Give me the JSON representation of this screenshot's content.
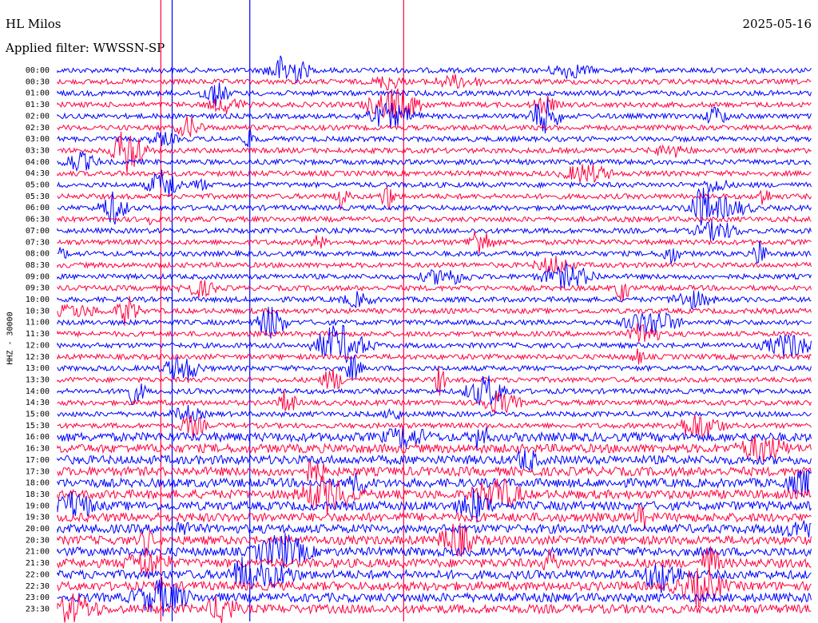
{
  "header": {
    "station": "HL Milos",
    "date": "2025-05-16",
    "filter": "Applied filter: WWSSN-SP"
  },
  "chart_data": {
    "type": "line",
    "title": "HL Milos",
    "subtitle": "Applied filter: WWSSN-SP",
    "ylabel": "HHZ - 30000",
    "xlabel": "",
    "grid": false,
    "colors": [
      "#0000ff",
      "#ff0040"
    ],
    "time_labels": [
      "00:00",
      "00:30",
      "01:00",
      "01:30",
      "02:00",
      "02:30",
      "03:00",
      "03:30",
      "04:00",
      "04:30",
      "05:00",
      "05:30",
      "06:00",
      "06:30",
      "07:00",
      "07:30",
      "08:00",
      "08:30",
      "09:00",
      "09:30",
      "10:00",
      "10:30",
      "11:00",
      "11:30",
      "12:00",
      "12:30",
      "13:00",
      "13:30",
      "14:00",
      "14:30",
      "15:00",
      "15:30",
      "16:00",
      "16:30",
      "17:00",
      "17:30",
      "18:00",
      "18:30",
      "19:00",
      "19:30",
      "20:00",
      "20:30",
      "21:00",
      "21:30",
      "22:00",
      "22:30",
      "23:00",
      "23:30"
    ],
    "series_note_vertical_spikes": [
      {
        "color": "#ff0040",
        "x_frac": 0.137
      },
      {
        "color": "#0000ff",
        "x_frac": 0.152
      },
      {
        "color": "#0000ff",
        "x_frac": 0.255
      },
      {
        "color": "#ff0040",
        "x_frac": 0.459
      }
    ]
  }
}
